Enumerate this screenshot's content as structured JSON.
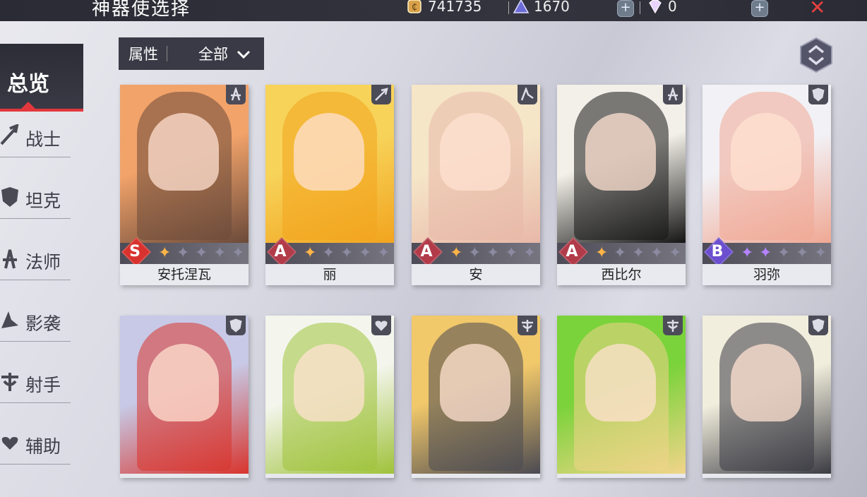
{
  "header": {
    "title": "神器使选择",
    "gold_value": "741735",
    "crystal_value": "1670",
    "diamond_value": "0",
    "add_symbol": "+",
    "close_symbol": "✕"
  },
  "sidebar": {
    "active_label": "总览",
    "items": [
      {
        "label": "战士",
        "icon": "sword-icon"
      },
      {
        "label": "坦克",
        "icon": "shield-icon"
      },
      {
        "label": "法师",
        "icon": "staff-icon"
      },
      {
        "label": "影袭",
        "icon": "dagger-icon"
      },
      {
        "label": "射手",
        "icon": "bow-icon"
      },
      {
        "label": "辅助",
        "icon": "heart-hands-icon"
      }
    ]
  },
  "filter": {
    "key": "属性",
    "value": "全部"
  },
  "colors": {
    "accent_red": "#e2383d",
    "rank_S": "#d8322e",
    "rank_A": "#b23b4a",
    "rank_B": "#6b4fcf",
    "star_gold": "#ffb447",
    "star_purple": "#b483ff",
    "star_empty": "#8c8aa0"
  },
  "cards": [
    {
      "name": "安托涅瓦",
      "rank": "S",
      "stars": 1,
      "class_icon": "staff-icon"
    },
    {
      "name": "丽",
      "rank": "A",
      "stars": 1,
      "class_icon": "sword-icon"
    },
    {
      "name": "安",
      "rank": "A",
      "stars": 1,
      "class_icon": "dagger-icon"
    },
    {
      "name": "西比尔",
      "rank": "A",
      "stars": 1,
      "class_icon": "staff-icon"
    },
    {
      "name": "羽弥",
      "rank": "B",
      "stars": 2,
      "class_icon": "shield-icon"
    },
    {
      "name": "",
      "rank": "",
      "stars": 0,
      "class_icon": "shield-icon"
    },
    {
      "name": "",
      "rank": "",
      "stars": 0,
      "class_icon": "heart-hands-icon"
    },
    {
      "name": "",
      "rank": "",
      "stars": 0,
      "class_icon": "bow-icon"
    },
    {
      "name": "",
      "rank": "",
      "stars": 0,
      "class_icon": "bow-icon"
    },
    {
      "name": "",
      "rank": "",
      "stars": 0,
      "class_icon": "shield-icon"
    }
  ]
}
